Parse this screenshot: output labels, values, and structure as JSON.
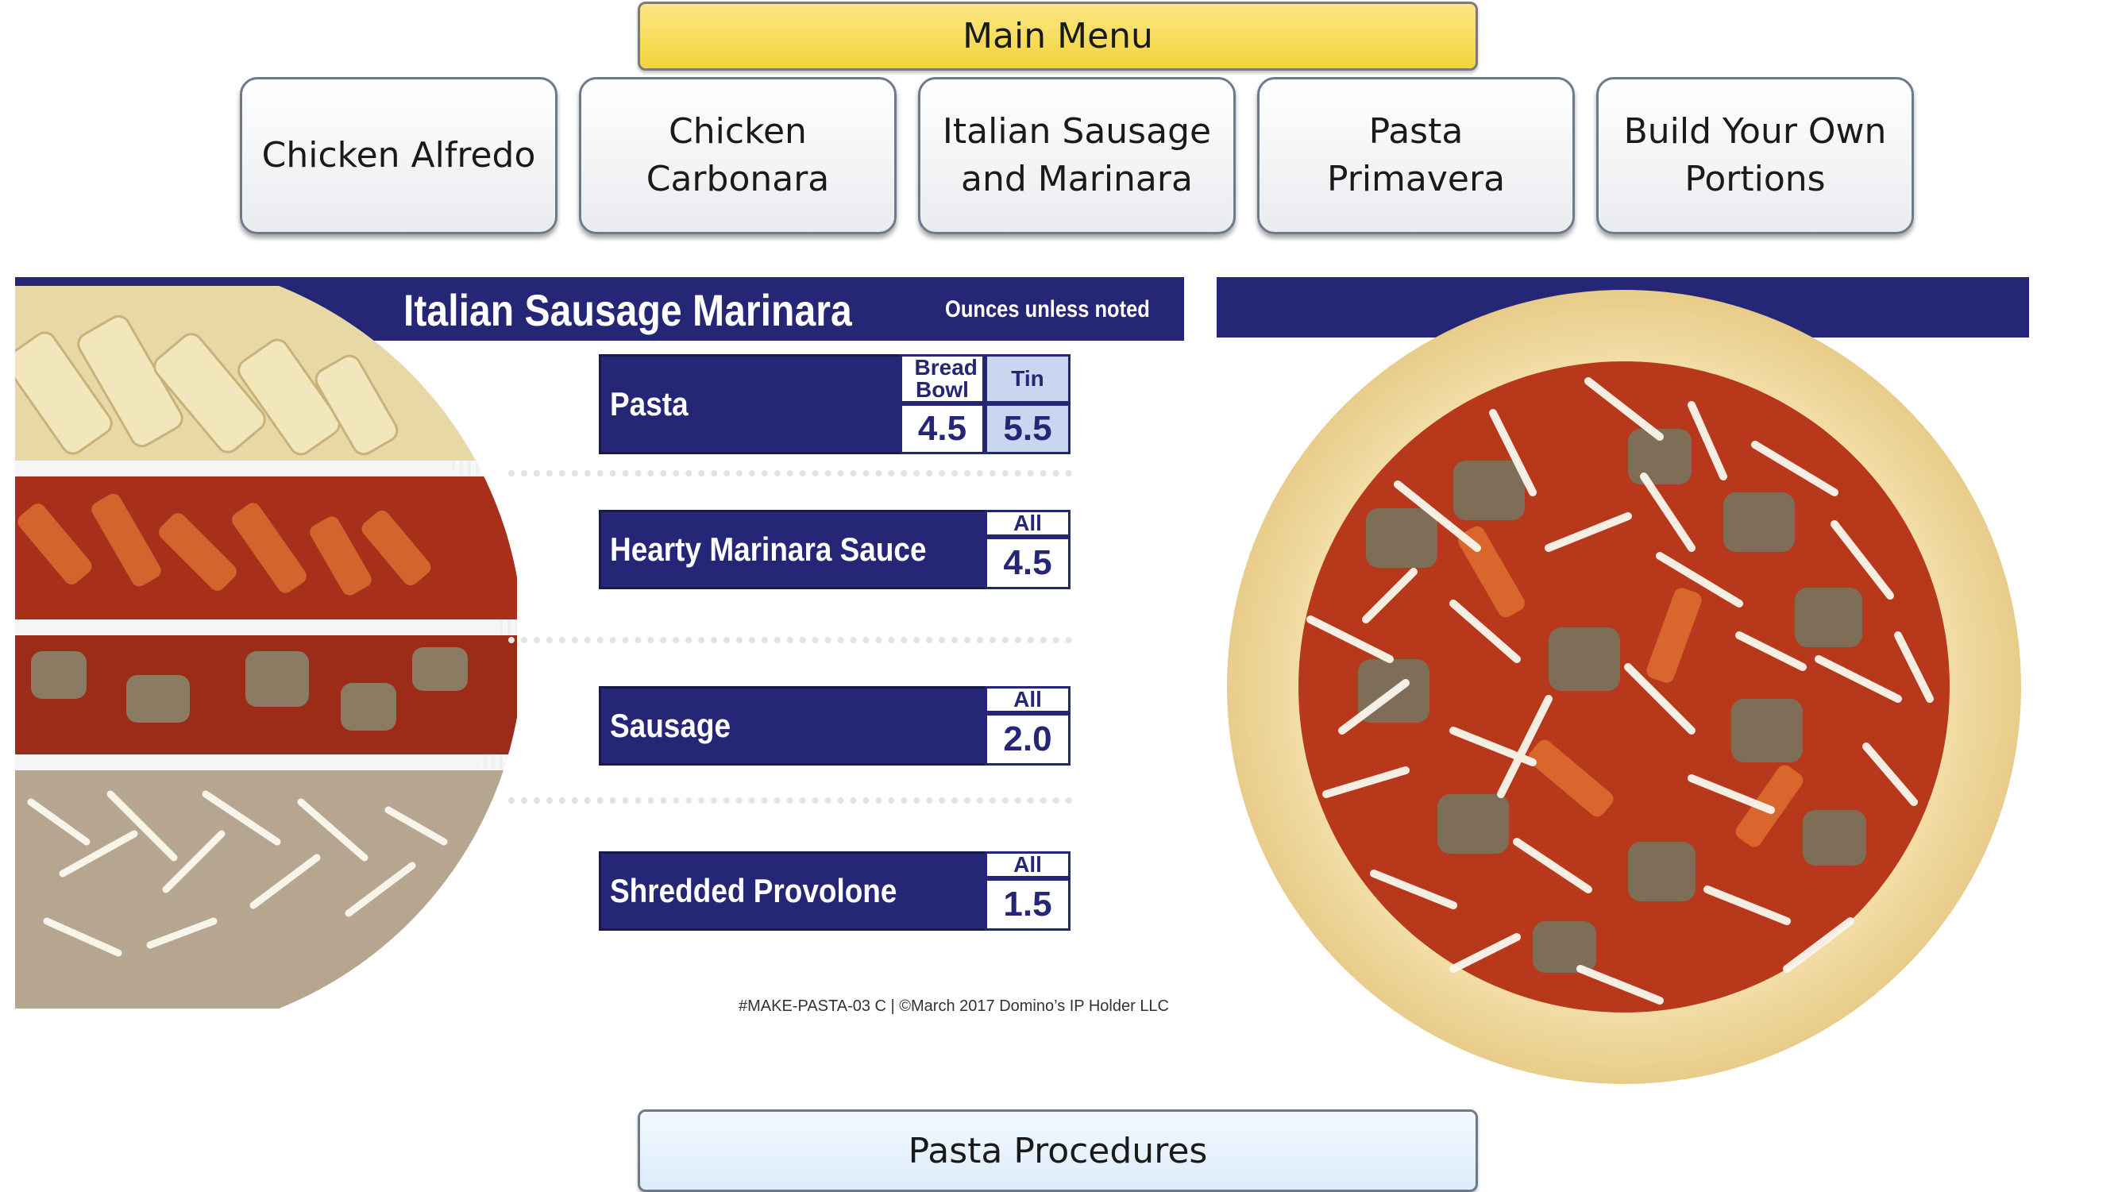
{
  "nav": {
    "main_menu": "Main Menu",
    "recipes": [
      {
        "label": "Chicken Alfredo"
      },
      {
        "label": "Chicken\nCarbonara"
      },
      {
        "label": "Italian Sausage\nand Marinara"
      },
      {
        "label": "Pasta Primavera"
      },
      {
        "label": "Build Your Own\nPortions"
      }
    ],
    "procedures": "Pasta Procedures"
  },
  "card": {
    "title": "Italian Sausage Marinara",
    "note": "Ounces unless noted",
    "ingredients": [
      {
        "name": "Pasta",
        "amounts": [
          {
            "head": "Bread Bowl",
            "value": "4.5"
          },
          {
            "head": "Tin",
            "value": "5.5"
          }
        ]
      },
      {
        "name": "Hearty Marinara Sauce",
        "amounts": [
          {
            "head": "All",
            "value": "4.5"
          }
        ]
      },
      {
        "name": "Sausage",
        "amounts": [
          {
            "head": "All",
            "value": "2.0"
          }
        ]
      },
      {
        "name": "Shredded Provolone",
        "amounts": [
          {
            "head": "All",
            "value": "1.5"
          }
        ]
      }
    ],
    "legal": "#MAKE-PASTA-03 C | ©March 2017 Domino’s IP Holder LLC"
  },
  "colors": {
    "navy": "#262676",
    "menu_yellow": "#f2d43a",
    "procedures_blue": "#dcecfa",
    "tin_header_blue": "#c8d6ef"
  },
  "images": {
    "tin": "pasta-tin-layers-photo",
    "pizza": "bread-bowl-pasta-photo"
  }
}
